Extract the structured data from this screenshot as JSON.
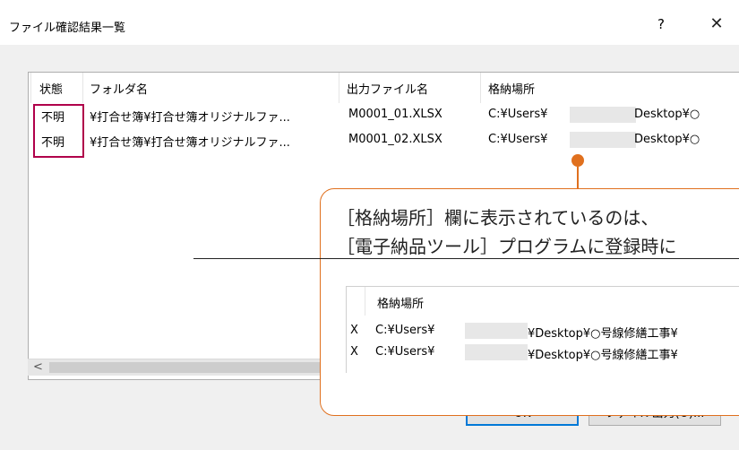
{
  "window": {
    "title": "ファイル確認結果一覧",
    "help_label": "?",
    "close_label": "✕"
  },
  "table": {
    "columns": [
      "状態",
      "フォルダ名",
      "出力ファイル名",
      "格納場所"
    ],
    "rows": [
      {
        "status": "不明",
        "folder": "¥打合せ簿¥打合せ簿オリジナルファ...",
        "file": "M0001_01.XLSX",
        "location_prefix": "C:¥Users¥",
        "location_suffix": "Desktop¥○"
      },
      {
        "status": "不明",
        "folder": "¥打合せ簿¥打合せ簿オリジナルファ...",
        "file": "M0001_02.XLSX",
        "location_prefix": "C:¥Users¥",
        "location_suffix": "Desktop¥○"
      }
    ]
  },
  "scrollbar": {
    "left_arrow": "<"
  },
  "buttons": {
    "ok": "OK",
    "file_output": "ファイル出力(O)..."
  },
  "callout": {
    "line1": "［格納場所］欄に表示されているのは、",
    "line2": "［電子納品ツール］プログラムに登録時に",
    "inner_header": "格納場所",
    "inner_rows": [
      {
        "mark": "X",
        "prefix": "C:¥Users¥",
        "suffix": "¥Desktop¥○号線修繕工事¥"
      },
      {
        "mark": "X",
        "prefix": "C:¥Users¥",
        "suffix": "¥Desktop¥○号線修繕工事¥"
      }
    ]
  },
  "colors": {
    "accent": "#e0701e",
    "highlight": "#b0004a",
    "focus": "#0078d7"
  }
}
